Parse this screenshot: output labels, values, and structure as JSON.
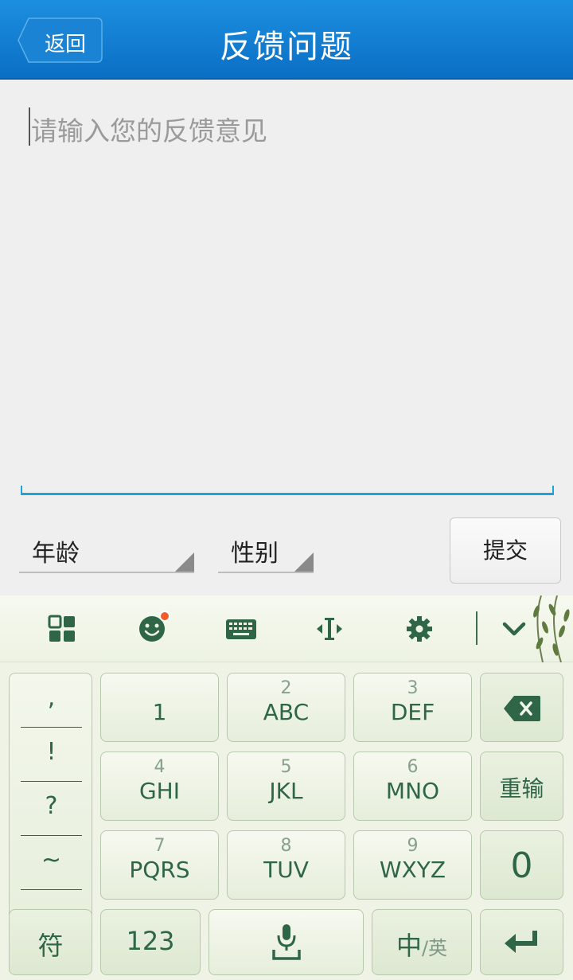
{
  "header": {
    "back_label": "返回",
    "title": "反馈问题",
    "color": "#0a77cc"
  },
  "feedback": {
    "placeholder": "请输入您的反馈意见",
    "value": ""
  },
  "form": {
    "age_label": "年龄",
    "gender_label": "性别",
    "submit_label": "提交"
  },
  "keyboard": {
    "accent_color": "#2f6648",
    "toolbar": {
      "icons": [
        "grid-icon",
        "emoji-icon",
        "keyboard-icon",
        "cursor-move-icon",
        "settings-icon",
        "collapse-icon"
      ]
    },
    "punctuation": [
      ",",
      "!",
      "?",
      "~"
    ],
    "keys": {
      "k1": {
        "num": "",
        "letters": "1"
      },
      "k2": {
        "num": "2",
        "letters": "ABC"
      },
      "k3": {
        "num": "3",
        "letters": "DEF"
      },
      "k4": {
        "num": "4",
        "letters": "GHI"
      },
      "k5": {
        "num": "5",
        "letters": "JKL"
      },
      "k6": {
        "num": "6",
        "letters": "MNO"
      },
      "k7": {
        "num": "7",
        "letters": "PQRS"
      },
      "k8": {
        "num": "8",
        "letters": "TUV"
      },
      "k9": {
        "num": "9",
        "letters": "WXYZ"
      }
    },
    "reinput_label": "重输",
    "zero_label": "0",
    "symbol_label": "符",
    "numeric_label": "123",
    "lang_main": "中",
    "lang_alt": "/英"
  }
}
